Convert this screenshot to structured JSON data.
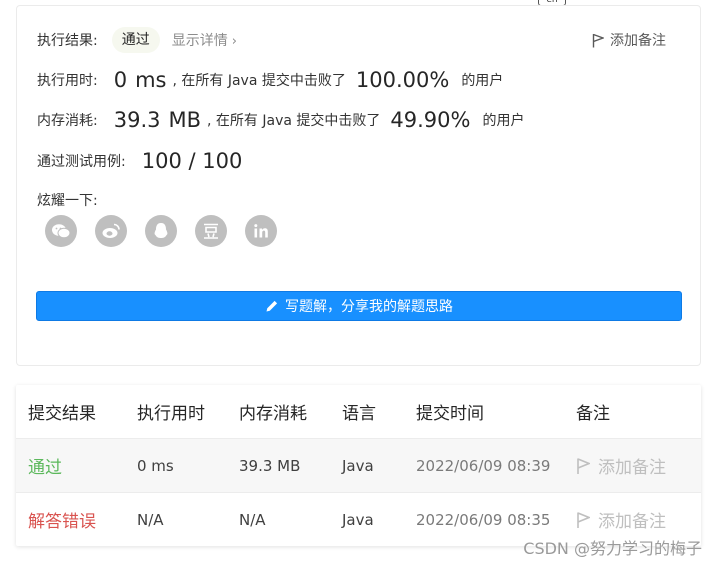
{
  "lang_badge": "en",
  "summary": {
    "result_label": "执行结果:",
    "result_value": "通过",
    "details_link": "显示详情",
    "add_note": "添加备注",
    "runtime_label": "执行用时:",
    "runtime_value": "0",
    "runtime_unit": "ms",
    "runtime_text": ", 在所有 Java 提交中击败了",
    "runtime_percent": "100.00%",
    "runtime_tail": "的用户",
    "memory_label": "内存消耗:",
    "memory_value": "39.3",
    "memory_unit": "MB",
    "memory_text": ", 在所有 Java 提交中击败了",
    "memory_percent": "49.90%",
    "memory_tail": "的用户",
    "tests_label": "通过测试用例:",
    "tests_value": "100 / 100",
    "share_label": "炫耀一下:",
    "share_icons": [
      "wechat-icon",
      "weibo-icon",
      "qq-icon",
      "douban-icon",
      "linkedin-icon"
    ],
    "write_button": "写题解，分享我的解题思路"
  },
  "table": {
    "headers": [
      "提交结果",
      "执行用时",
      "内存消耗",
      "语言",
      "提交时间",
      "备注"
    ],
    "rows": [
      {
        "result": "通过",
        "runtime": "0 ms",
        "memory": "39.3 MB",
        "language": "Java",
        "time": "2022/06/09 08:39",
        "note": "添加备注"
      },
      {
        "result": "解答错误",
        "runtime": "N/A",
        "memory": "N/A",
        "language": "Java",
        "time": "2022/06/09 08:35",
        "note": "添加备注"
      }
    ]
  },
  "watermark": "CSDN @努力学习的梅子",
  "colors": {
    "accent": "#1890ff",
    "pass": "#5cb85c",
    "fail": "#d9534f",
    "icon_gray": "#bfbfbf"
  }
}
